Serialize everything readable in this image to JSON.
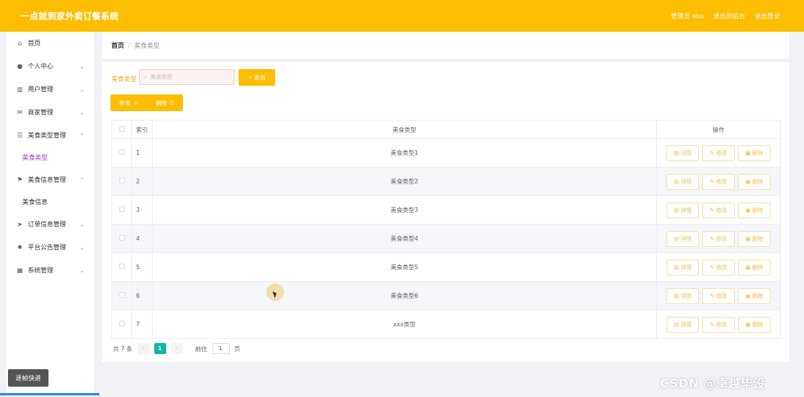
{
  "header": {
    "title": "一点就到家外卖订餐系统",
    "user_label": "管理员 abo",
    "back_to_front": "退出到前台",
    "logout": "退出登录"
  },
  "sidebar": {
    "items": [
      {
        "label": "首页",
        "icon": "home-icon",
        "expandable": false
      },
      {
        "label": "个人中心",
        "icon": "user-icon",
        "expandable": true
      },
      {
        "label": "用户管理",
        "icon": "chart-icon",
        "expandable": true
      },
      {
        "label": "商家管理",
        "icon": "mail-icon",
        "expandable": true
      },
      {
        "label": "美食类型管理",
        "icon": "menu-icon",
        "expandable": true,
        "expanded": true
      },
      {
        "label": "美食类型",
        "sub": true,
        "active": true
      },
      {
        "label": "美食信息管理",
        "icon": "flag-icon",
        "expandable": true,
        "expanded": true
      },
      {
        "label": "美食信息",
        "sub": true
      },
      {
        "label": "订单信息管理",
        "icon": "send-icon",
        "expandable": true
      },
      {
        "label": "平台公告管理",
        "icon": "settings-icon",
        "expandable": true
      },
      {
        "label": "系统管理",
        "icon": "grid-icon",
        "expandable": true
      }
    ],
    "quick_button": "逐帧快进"
  },
  "breadcrumb": {
    "home": "首页",
    "separator": "/",
    "current": "美食类型"
  },
  "search": {
    "label": "美食类型",
    "placeholder": "美食类型",
    "button": "查询"
  },
  "actions": {
    "add": "新增",
    "delete": "删除"
  },
  "table": {
    "columns": [
      "",
      "索引",
      "美食类型",
      "操作"
    ],
    "rows": [
      {
        "index": "1",
        "type": "美食类型1"
      },
      {
        "index": "2",
        "type": "美食类型2"
      },
      {
        "index": "3",
        "type": "美食类型3"
      },
      {
        "index": "4",
        "type": "美食类型4"
      },
      {
        "index": "5",
        "type": "美食类型5"
      },
      {
        "index": "6",
        "type": "美食类型6"
      },
      {
        "index": "7",
        "type": "xxx类型"
      }
    ],
    "row_actions": {
      "detail": "详情",
      "edit": "修改",
      "delete": "删除"
    }
  },
  "pagination": {
    "total": "共 7 条",
    "current_page": "1",
    "goto_prefix": "前往",
    "goto_value": "1",
    "goto_suffix": "页"
  },
  "watermark": "CSDN @卓越毕设",
  "colors": {
    "accent": "#fdbd00",
    "active_menu": "#9b3fc2",
    "pager_active": "#13b5a1"
  }
}
